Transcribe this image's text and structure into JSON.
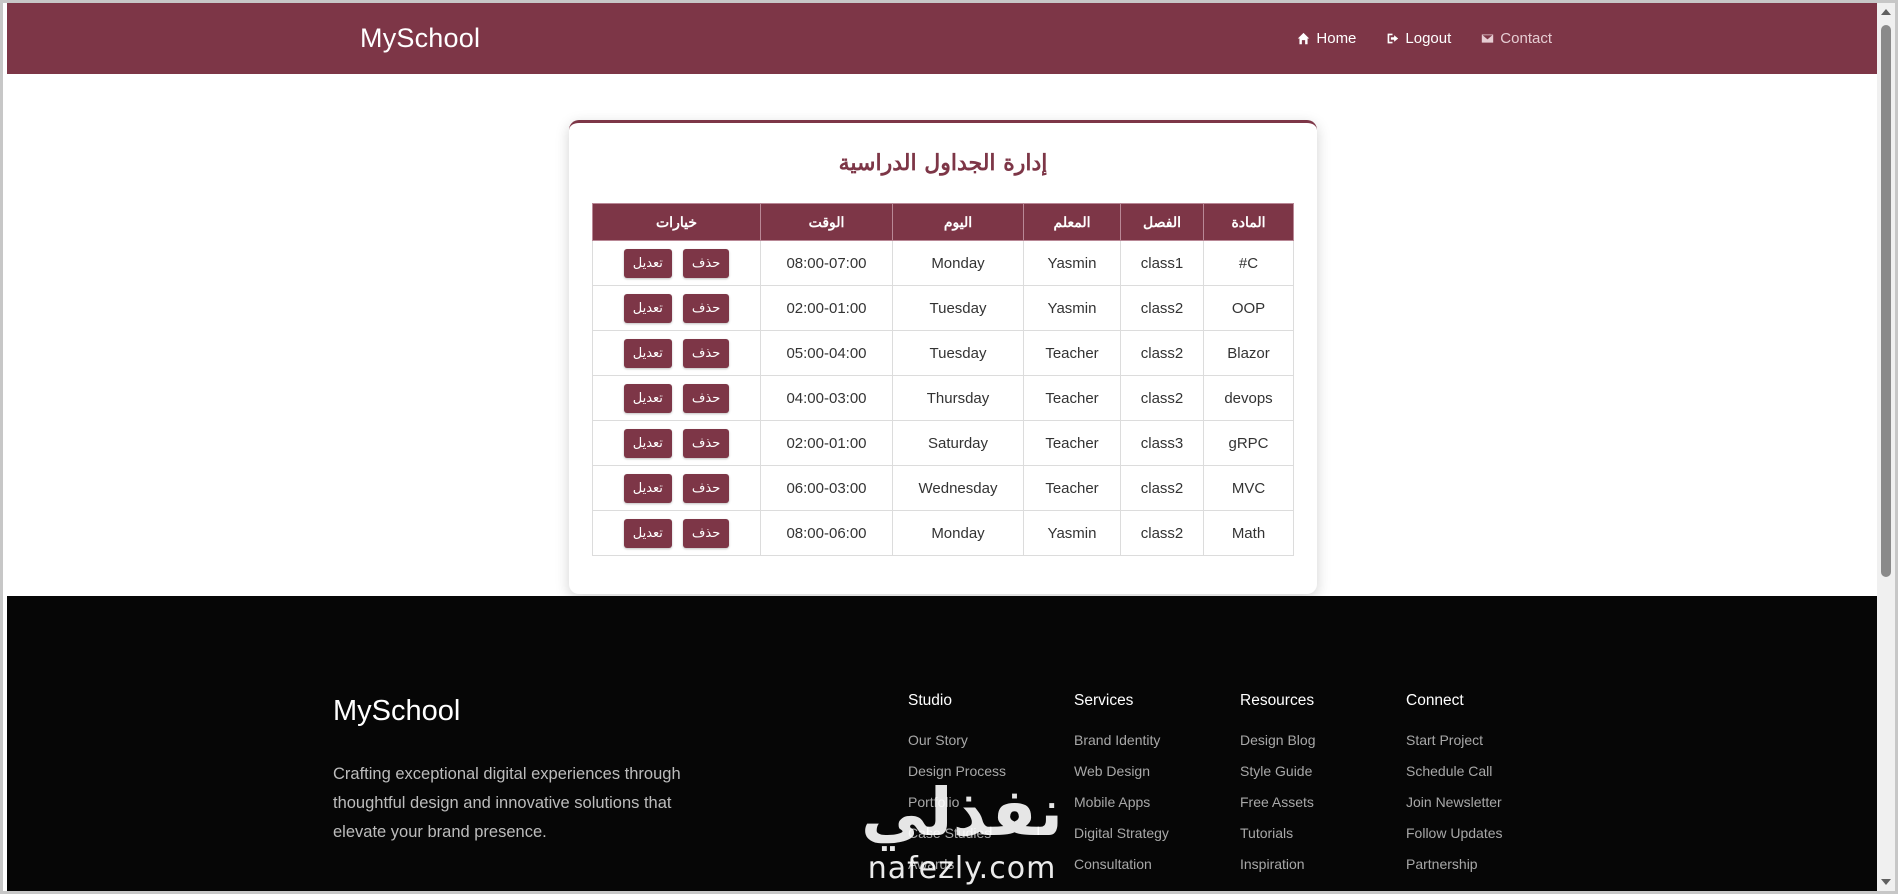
{
  "navbar": {
    "brand": "MySchool",
    "links": [
      {
        "label": "Home",
        "icon": "home-icon"
      },
      {
        "label": "Logout",
        "icon": "logout-icon"
      },
      {
        "label": "Contact",
        "icon": "envelope-icon"
      }
    ],
    "background": "#7d3647"
  },
  "card": {
    "title": "إدارة الجداول الدراسية",
    "headers": [
      "المادة",
      "الفصل",
      "المعلم",
      "اليوم",
      "الوقت",
      "خيارات"
    ],
    "edit_label": "تعديل",
    "delete_label": "حذف",
    "rows": [
      {
        "subject": "C#",
        "class": "class1",
        "teacher": "Yasmin",
        "day": "Monday",
        "time": "08:00-07:00"
      },
      {
        "subject": "OOP",
        "class": "class2",
        "teacher": "Yasmin",
        "day": "Tuesday",
        "time": "02:00-01:00"
      },
      {
        "subject": "Blazor",
        "class": "class2",
        "teacher": "Teacher",
        "day": "Tuesday",
        "time": "05:00-04:00"
      },
      {
        "subject": "devops",
        "class": "class2",
        "teacher": "Teacher",
        "day": "Thursday",
        "time": "04:00-03:00"
      },
      {
        "subject": "gRPC",
        "class": "class3",
        "teacher": "Teacher",
        "day": "Saturday",
        "time": "02:00-01:00"
      },
      {
        "subject": "MVC",
        "class": "class2",
        "teacher": "Teacher",
        "day": "Wednesday",
        "time": "06:00-03:00"
      },
      {
        "subject": "Math",
        "class": "class2",
        "teacher": "Yasmin",
        "day": "Monday",
        "time": "08:00-06:00"
      }
    ]
  },
  "footer": {
    "brand": "MySchool",
    "description": "Crafting exceptional digital experiences through thoughtful design and innovative solutions that elevate your brand presence.",
    "columns": [
      {
        "title": "Studio",
        "links": [
          "Our Story",
          "Design Process",
          "Portfolio",
          "Case Studies",
          "Awards"
        ]
      },
      {
        "title": "Services",
        "links": [
          "Brand Identity",
          "Web Design",
          "Mobile Apps",
          "Digital Strategy",
          "Consultation"
        ]
      },
      {
        "title": "Resources",
        "links": [
          "Design Blog",
          "Style Guide",
          "Free Assets",
          "Tutorials",
          "Inspiration"
        ]
      },
      {
        "title": "Connect",
        "links": [
          "Start Project",
          "Schedule Call",
          "Join Newsletter",
          "Follow Updates",
          "Partnership"
        ]
      }
    ]
  },
  "watermark": {
    "arabic": "نفذلي",
    "latin": "nafezly.com"
  }
}
